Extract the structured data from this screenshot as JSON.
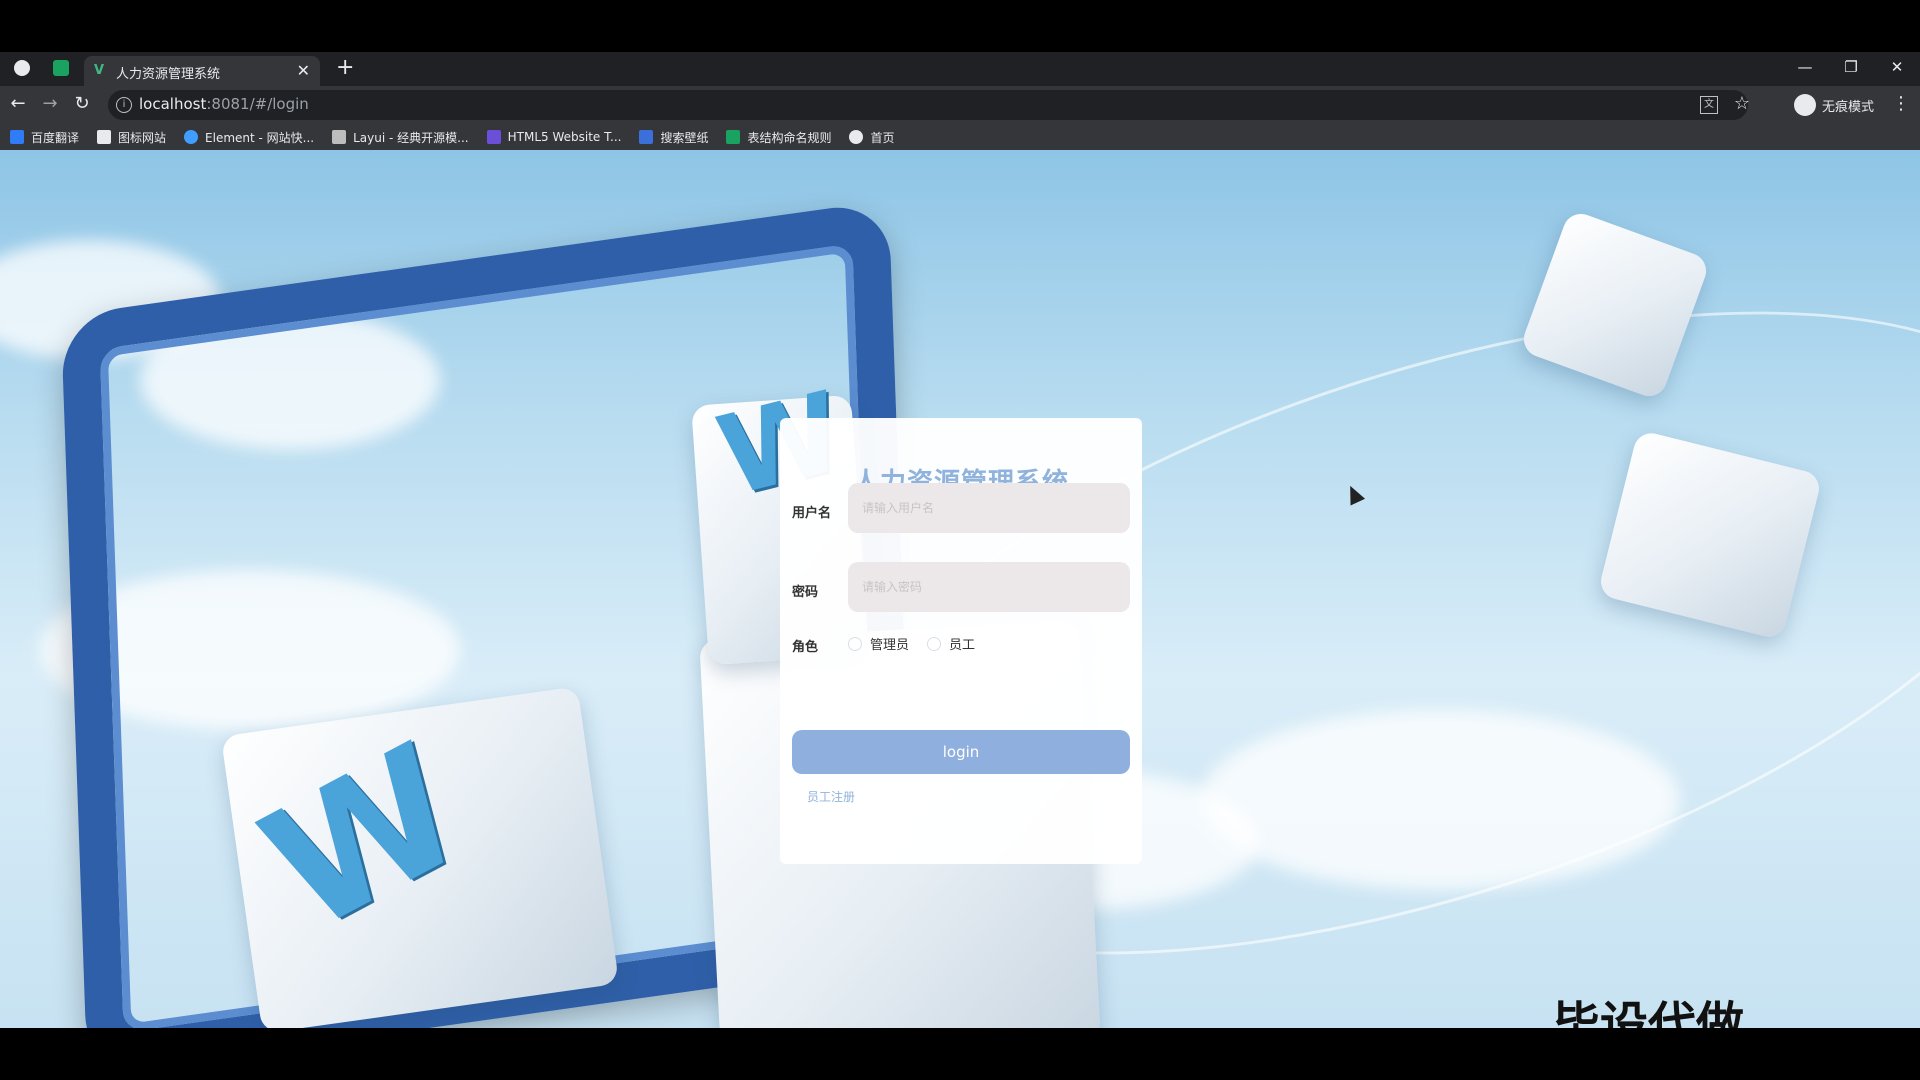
{
  "browser": {
    "tab": {
      "title": "人力资源管理系统",
      "close_glyph": "✕"
    },
    "new_tab_glyph": "+",
    "window_controls": {
      "minimize": "—",
      "restore": "❐",
      "close": "✕"
    },
    "address": {
      "host": "localhost",
      "rest": ":8081/#/login"
    },
    "profile_label": "无痕模式",
    "bookmarks": [
      {
        "label": "百度翻译",
        "icon": "baidu-translate-icon",
        "color": "#2f7cf6"
      },
      {
        "label": "图标网站",
        "icon": "flag-icon",
        "color": "#e8eaed"
      },
      {
        "label": "Element - 网站快...",
        "icon": "element-icon",
        "color": "#409eff"
      },
      {
        "label": "Layui - 经典开源模...",
        "icon": "layui-icon",
        "color": "#bdbdbd"
      },
      {
        "label": "HTML5 Website T...",
        "icon": "html5-icon",
        "color": "#6b4fd8"
      },
      {
        "label": "搜索壁纸",
        "icon": "wallpaper-icon",
        "color": "#3b6fd9"
      },
      {
        "label": "表结构命名规则",
        "icon": "sheet-icon",
        "color": "#1aa260"
      },
      {
        "label": "首页",
        "icon": "globe-icon",
        "color": "#e8eaed"
      }
    ]
  },
  "login": {
    "title": "人力资源管理系统",
    "username": {
      "label": "用户名",
      "placeholder": "请输入用户名"
    },
    "password": {
      "label": "密码",
      "placeholder": "请输入密码"
    },
    "role": {
      "label": "角色",
      "options": [
        "管理员",
        "员工"
      ]
    },
    "submit_label": "login",
    "register_label": "员工注册"
  },
  "watermark_text": "毕设代做",
  "colors": {
    "accent": "#8fb0de",
    "title": "#8fb3dc",
    "frame": "#2f5fa8"
  }
}
